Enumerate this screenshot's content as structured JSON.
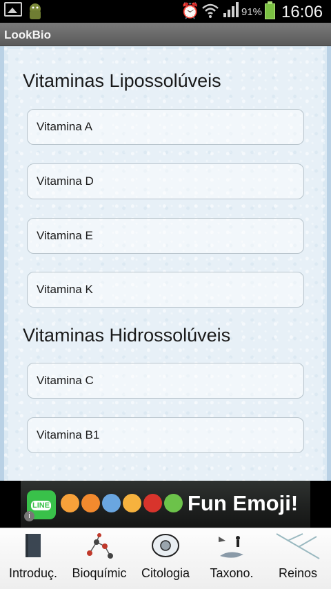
{
  "status_bar": {
    "battery_percent": "91%",
    "time": "16:06",
    "icons": [
      "image-icon",
      "android-icon",
      "alarm-icon",
      "wifi-icon",
      "signal-icon",
      "battery-icon"
    ]
  },
  "app": {
    "title": "LookBio"
  },
  "sections": [
    {
      "title": "Vitaminas Lipossolúveis",
      "items": [
        "Vitamina A",
        "Vitamina D",
        "Vitamina E",
        "Vitamina K"
      ]
    },
    {
      "title": "Vitaminas Hidrossolúveis",
      "items": [
        "Vitamina C",
        "Vitamina B1"
      ]
    }
  ],
  "ad": {
    "logo_text": "LINE",
    "text": "Fun Emoji!",
    "info_symbol": "i"
  },
  "tabs": [
    {
      "label": "Introduç.",
      "icon": "book-icon"
    },
    {
      "label": "Bioquímic",
      "icon": "molecule-icon"
    },
    {
      "label": "Citologia",
      "icon": "cell-icon"
    },
    {
      "label": "Taxono.",
      "icon": "taxonomy-icon"
    },
    {
      "label": "Reinos",
      "icon": "tree-icon"
    }
  ],
  "colors": {
    "content_bg": "#dbe9f3",
    "ad_line_green": "#39c14a",
    "battery_green": "#7bc043"
  }
}
